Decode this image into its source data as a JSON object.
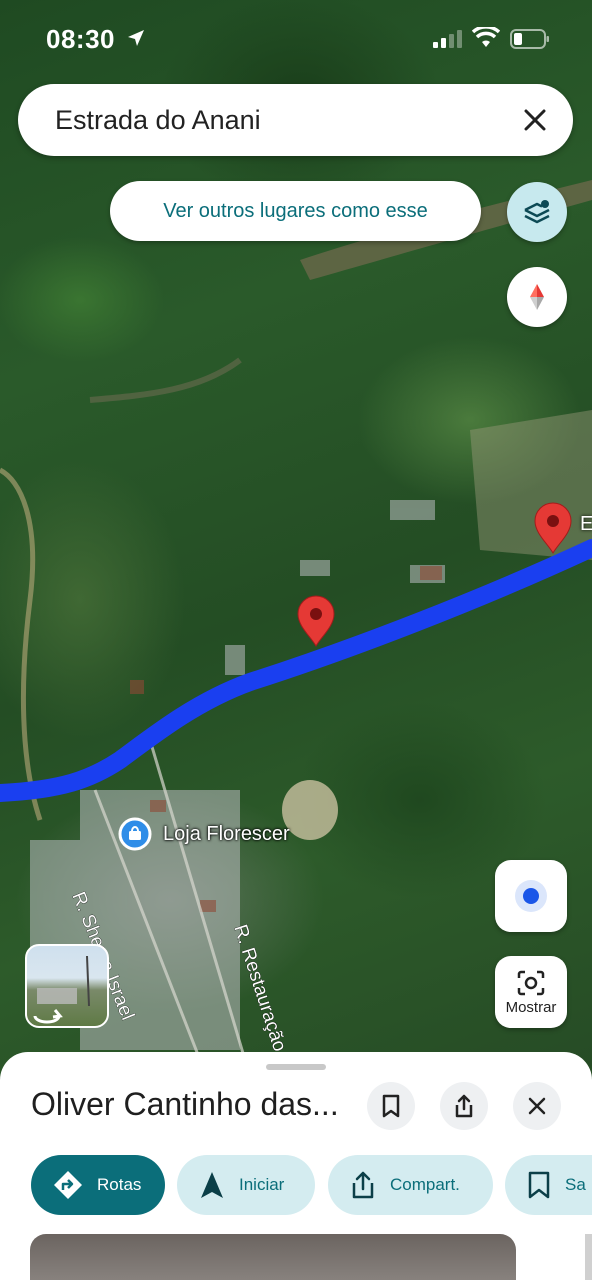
{
  "status_bar": {
    "time": "08:30"
  },
  "search": {
    "query": "Estrada do Anani"
  },
  "map": {
    "similar_places_chip": "Ver outros lugares como esse",
    "store_label": "Loja Florescer",
    "street_label_1": "R. Shema Israel",
    "street_label_2": "R. Restauração",
    "edge_label": "E",
    "lens_button_label": "Mostrar",
    "route_color": "#1a3ff0",
    "pin_color": "#e53935"
  },
  "sheet": {
    "title": "Oliver Cantinho das...",
    "actions": [
      {
        "label": "Rotas",
        "icon": "directions-icon"
      },
      {
        "label": "Iniciar",
        "icon": "navigation-arrow-icon"
      },
      {
        "label": "Compart.",
        "icon": "share-icon"
      },
      {
        "label": "Sa",
        "icon": "bookmark-icon"
      }
    ]
  },
  "colors": {
    "accent": "#0b6e7a",
    "accent_light": "#d4ecf0"
  }
}
